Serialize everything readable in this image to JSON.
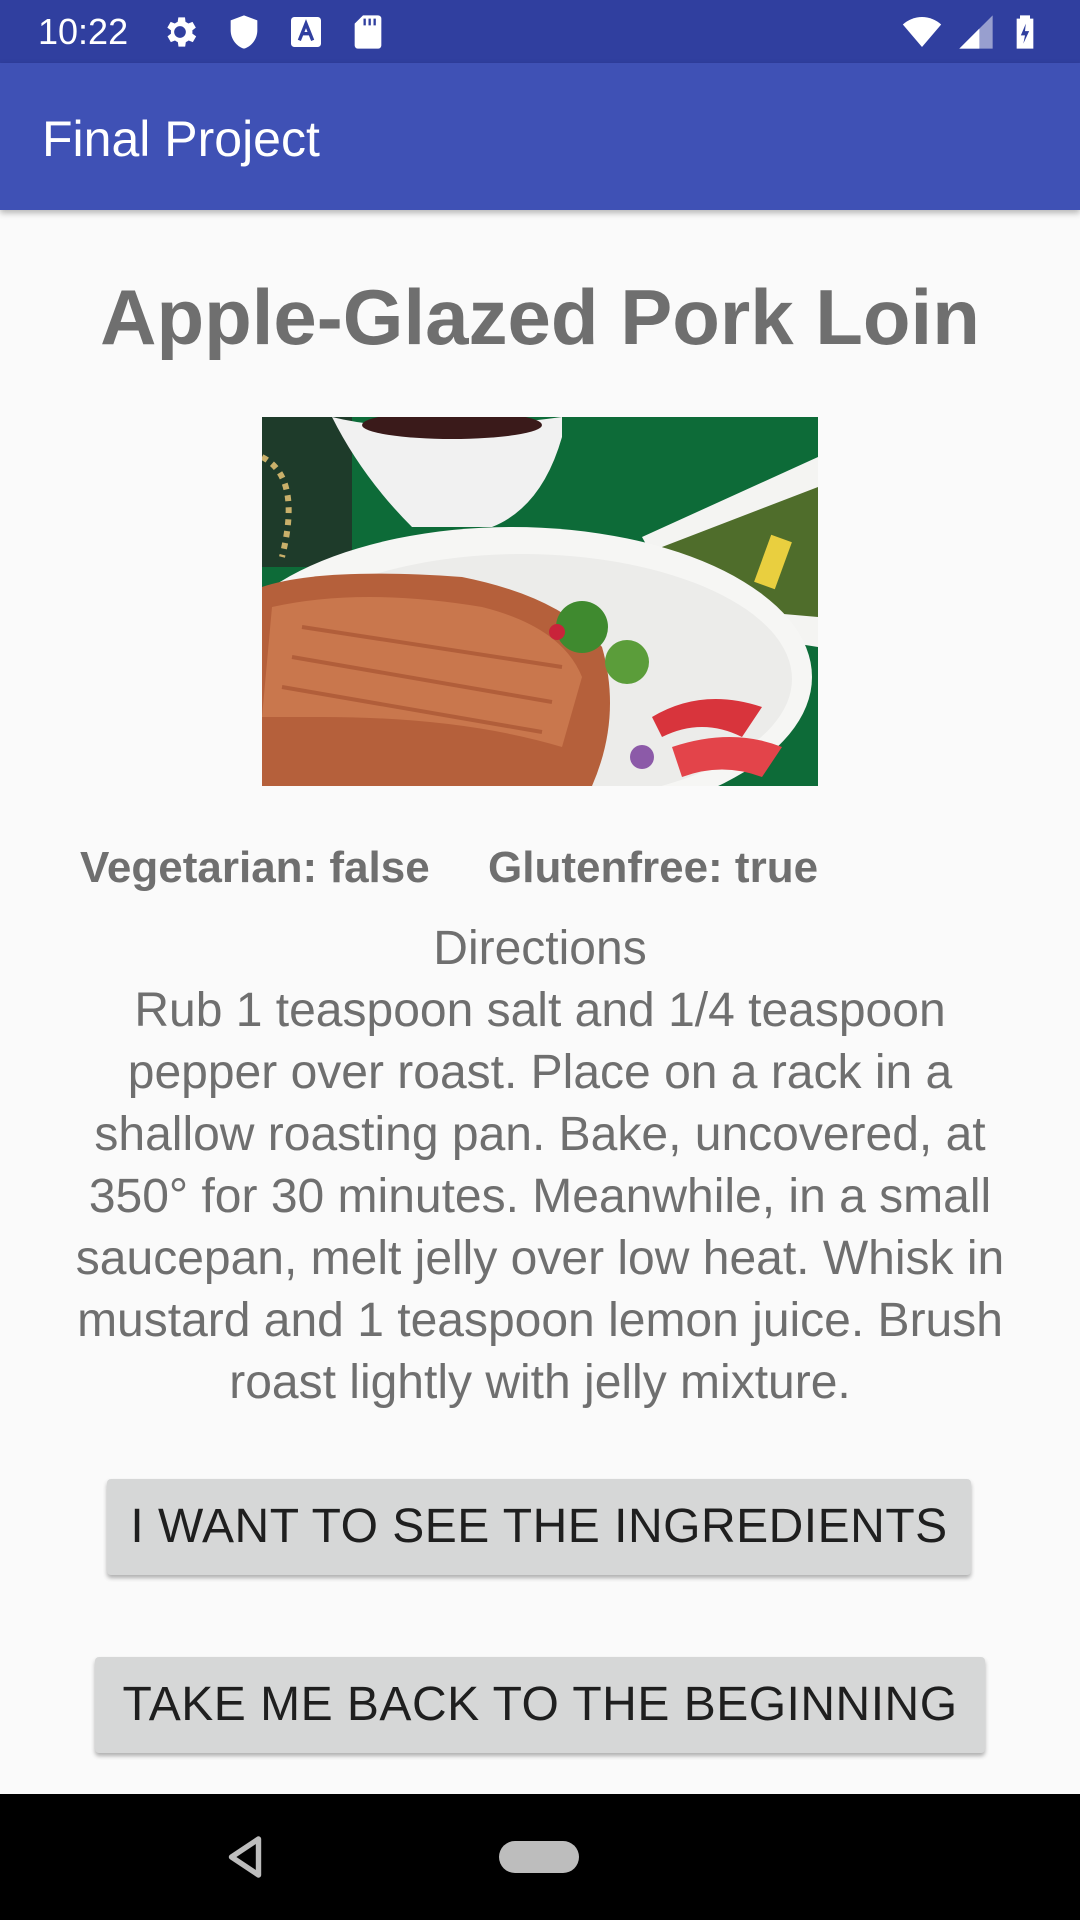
{
  "status_bar": {
    "time": "10:22",
    "left_icons": [
      "gear-icon",
      "shield-icon",
      "text-a-icon",
      "sd-card-icon"
    ],
    "right_icons": [
      "wifi-icon",
      "cell-signal-icon",
      "battery-charging-icon"
    ]
  },
  "app_bar": {
    "title": "Final Project"
  },
  "recipe": {
    "title": "Apple-Glazed Pork Loin",
    "image_alt": "pork-loin-photo",
    "vegetarian": "Vegetarian: false",
    "glutenfree": "Glutenfree: true",
    "directions_heading": "Directions",
    "directions_text": "Rub 1 teaspoon salt and 1/4 teaspoon pepper over roast. Place on a rack in a shallow roasting pan. Bake, uncovered, at 350° for 30 minutes. Meanwhile, in a small saucepan, melt jelly over low heat. Whisk in mustard and 1 teaspoon lemon juice. Brush roast lightly with jelly mixture."
  },
  "buttons": {
    "ingredients": "I WANT TO SEE THE INGREDIENTS",
    "back": "TAKE ME BACK TO THE BEGINNING"
  },
  "nav_bar": {
    "icons": [
      "back-icon",
      "home-pill-icon"
    ]
  },
  "colors": {
    "status_bar": "#303f9f",
    "app_bar": "#3f51b5",
    "background": "#fafafa",
    "text_gray": "#6f6f6f",
    "button": "#d6d7d7"
  }
}
